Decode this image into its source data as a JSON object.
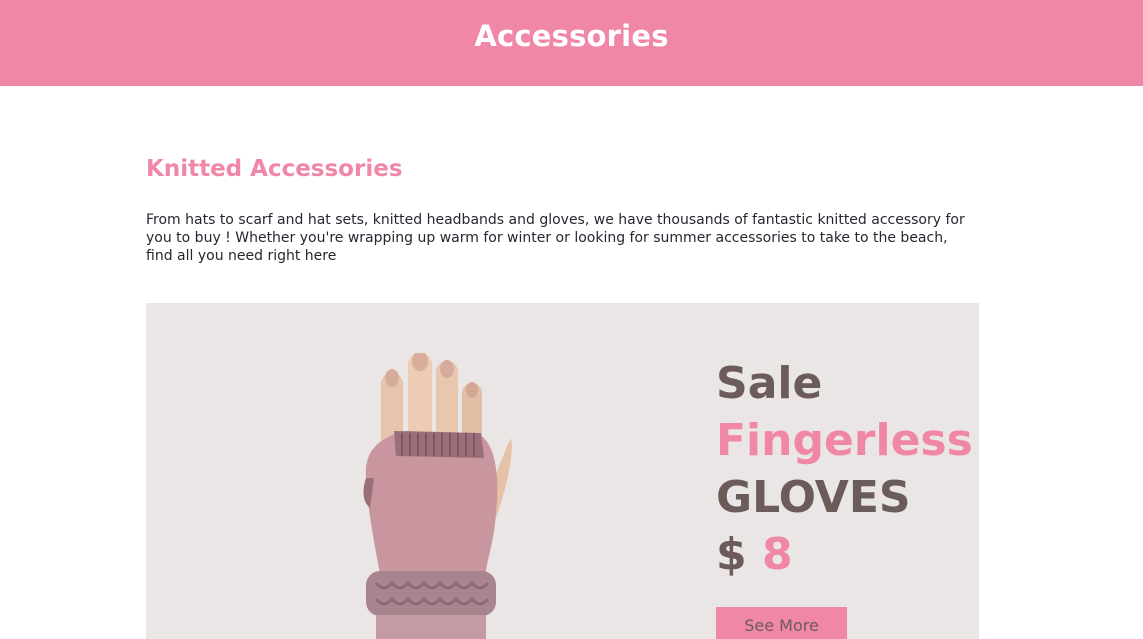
{
  "header": {
    "title": "Accessories"
  },
  "section": {
    "title": "Knitted Accessories",
    "description": "From hats to scarf and hat sets, knitted headbands and gloves, we have thousands of fantastic knitted accessory for you to buy ! Whether you're wrapping up warm for winter or looking for summer accessories to take to the beach, find all you need right here"
  },
  "promo": {
    "line1": "Sale",
    "line2": "Fingerless",
    "line3": "GLOVES",
    "currency": "$",
    "price": "8",
    "button_label": "See More",
    "image_alt": "fingerless-glove-image"
  },
  "colors": {
    "accent": "#f187a7",
    "text_brown": "#6b5b59",
    "promo_bg": "#eae6e6"
  }
}
